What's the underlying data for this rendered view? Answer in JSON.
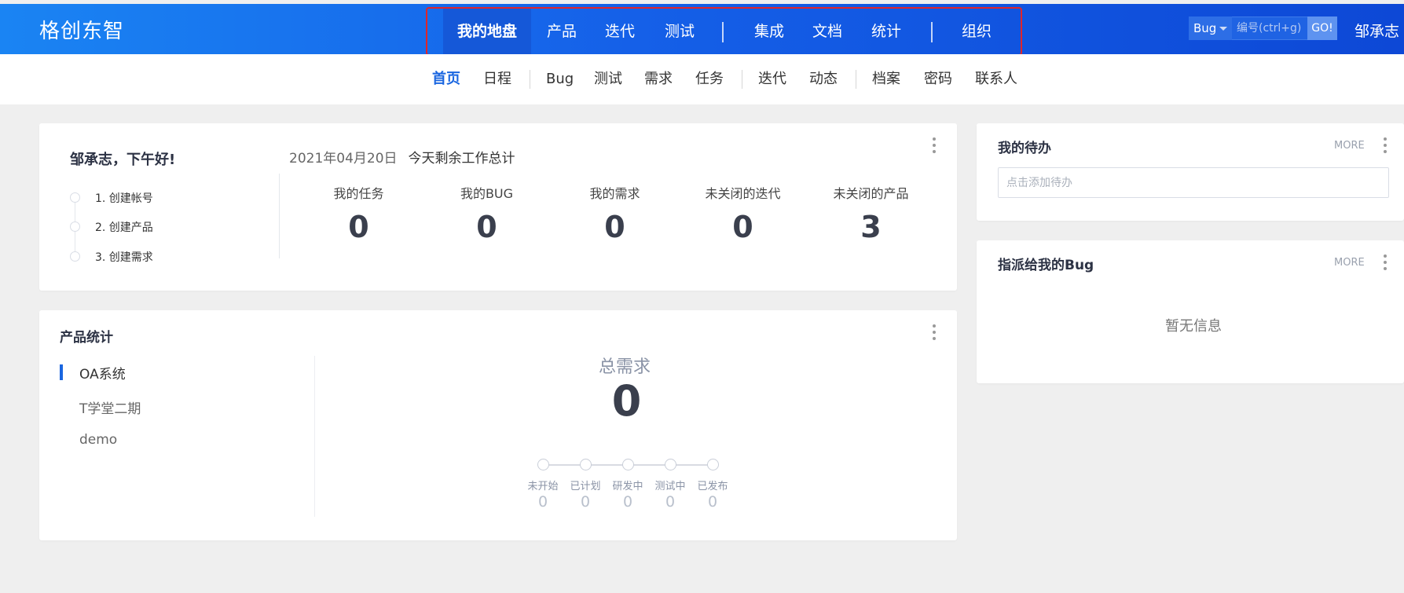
{
  "brand": "格创东智",
  "main_nav": {
    "items": [
      {
        "label": "我的地盘",
        "active": true
      },
      {
        "label": "产品"
      },
      {
        "label": "迭代"
      },
      {
        "label": "测试"
      },
      {
        "label": "集成"
      },
      {
        "label": "文档"
      },
      {
        "label": "统计"
      },
      {
        "label": "组织"
      }
    ]
  },
  "search": {
    "type": "Bug",
    "placeholder": "编号(ctrl+g)",
    "go_label": "GO!"
  },
  "user": {
    "name": "邹承志"
  },
  "sub_nav": {
    "items": [
      {
        "label": "首页",
        "active": true
      },
      {
        "label": "日程"
      },
      {
        "label": "Bug"
      },
      {
        "label": "测试"
      },
      {
        "label": "需求"
      },
      {
        "label": "任务"
      },
      {
        "label": "迭代"
      },
      {
        "label": "动态"
      },
      {
        "label": "档案"
      },
      {
        "label": "密码"
      },
      {
        "label": "联系人"
      }
    ]
  },
  "welcome": {
    "greeting": "邹承志，下午好!",
    "steps": [
      "1. 创建帐号",
      "2. 创建产品",
      "3. 创建需求"
    ],
    "date": "2021年04月20日",
    "summary_title": "今天剩余工作总计",
    "stats": [
      {
        "label": "我的任务",
        "value": "0"
      },
      {
        "label": "我的BUG",
        "value": "0"
      },
      {
        "label": "我的需求",
        "value": "0"
      },
      {
        "label": "未关闭的迭代",
        "value": "0"
      },
      {
        "label": "未关闭的产品",
        "value": "3"
      }
    ]
  },
  "product_stats": {
    "title": "产品统计",
    "products": [
      "OA系统",
      "T学堂二期",
      "demo"
    ],
    "total_label": "总需求",
    "total_value": "0",
    "stages": [
      {
        "label": "未开始",
        "count": "0"
      },
      {
        "label": "已计划",
        "count": "0"
      },
      {
        "label": "研发中",
        "count": "0"
      },
      {
        "label": "测试中",
        "count": "0"
      },
      {
        "label": "已发布",
        "count": "0"
      }
    ]
  },
  "todo": {
    "title": "我的待办",
    "more": "MORE",
    "placeholder": "点击添加待办"
  },
  "assigned_bugs": {
    "title": "指派给我的Bug",
    "more": "MORE",
    "empty": "暂无信息"
  },
  "colors": {
    "header_start": "#1a84f3",
    "header_end": "#0d48d6",
    "accent": "#1a66e0",
    "highlight_border": "#e0252a"
  }
}
